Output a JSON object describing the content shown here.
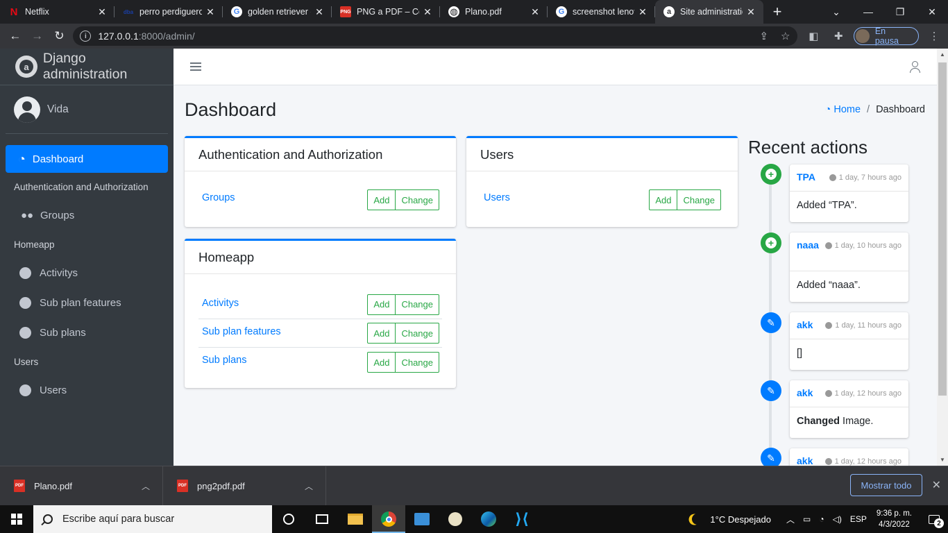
{
  "browser": {
    "tabs": [
      {
        "title": "Netflix",
        "favicon": "netflix-icon",
        "glyph": "N",
        "favicon_bg": "#202124",
        "favicon_fg": "#e50914"
      },
      {
        "title": "perro perdiguero",
        "favicon": "dba-icon",
        "glyph": "dba",
        "favicon_bg": "#202124",
        "favicon_fg": "#1a3fa6"
      },
      {
        "title": "golden retriever -",
        "favicon": "google-icon",
        "glyph": "G",
        "favicon_bg": "#ffffff",
        "favicon_fg": "#4285f4"
      },
      {
        "title": "PNG a PDF – Con",
        "favicon": "png2pdf-icon",
        "glyph": "P",
        "favicon_bg": "#d93025",
        "favicon_fg": "#ffffff"
      },
      {
        "title": "Plano.pdf",
        "favicon": "globe-icon",
        "glyph": "◍",
        "favicon_bg": "#ffffff",
        "favicon_fg": "#202124"
      },
      {
        "title": "screenshot lenov",
        "favicon": "google-icon",
        "glyph": "G",
        "favicon_bg": "#ffffff",
        "favicon_fg": "#4285f4"
      },
      {
        "title": "Site administratic",
        "favicon": "django-admin-icon",
        "glyph": "a",
        "favicon_bg": "#ffffff",
        "favicon_fg": "#35363a",
        "active": true
      }
    ],
    "url_host": "127.0.0.1",
    "url_path": ":8000/admin/",
    "profile_status": "En pausa"
  },
  "sidebar": {
    "brand": "Django administration",
    "user": "Vida",
    "dashboard_label": "Dashboard",
    "sections": [
      {
        "header": "Authentication and Authorization",
        "items": [
          {
            "label": "Groups",
            "icon": "users-icon"
          }
        ]
      },
      {
        "header": "Homeapp",
        "items": [
          {
            "label": "Activitys",
            "icon": "circle-icon"
          },
          {
            "label": "Sub plan features",
            "icon": "circle-icon"
          },
          {
            "label": "Sub plans",
            "icon": "circle-icon"
          }
        ]
      },
      {
        "header": "Users",
        "items": [
          {
            "label": "Users",
            "icon": "circle-icon"
          }
        ]
      }
    ]
  },
  "main": {
    "page_title": "Dashboard",
    "breadcrumb": {
      "home": "Home",
      "separator": "/",
      "current": "Dashboard"
    },
    "add_label": "Add",
    "change_label": "Change",
    "apps": [
      {
        "name": "Authentication and Authorization",
        "models": [
          "Groups"
        ]
      },
      {
        "name": "Users",
        "models": [
          "Users"
        ]
      },
      {
        "name": "Homeapp",
        "models": [
          "Activitys",
          "Sub plan features",
          "Sub plans"
        ]
      }
    ],
    "recent_actions": {
      "title": "Recent actions",
      "items": [
        {
          "object": "TPA",
          "time": "1 day, 7 hours ago",
          "type": "add",
          "verb": "",
          "text": "Added “TPA”."
        },
        {
          "object": "naaa",
          "time": "1 day, 10 hours ago",
          "type": "add",
          "verb": "",
          "text": "Added “naaa”."
        },
        {
          "object": "akk",
          "time": "1 day, 11 hours ago",
          "type": "change",
          "verb": "",
          "text": "[]"
        },
        {
          "object": "akk",
          "time": "1 day, 12 hours ago",
          "type": "change",
          "verb": "Changed",
          "text": " Image."
        },
        {
          "object": "akk",
          "time": "1 day, 12 hours ago",
          "type": "change",
          "verb": "",
          "text": ""
        }
      ]
    }
  },
  "downloads": {
    "items": [
      "Plano.pdf",
      "png2pdf.pdf"
    ],
    "file_badge": "PDF",
    "show_all": "Mostrar todo"
  },
  "taskbar": {
    "search_placeholder": "Escribe aquí para buscar",
    "weather": "1°C  Despejado",
    "language": "ESP",
    "time": "9:36 p. m.",
    "date": "4/3/2022",
    "notifications": "2"
  },
  "colors": {
    "primary": "#007bff",
    "success": "#28a745",
    "sidebar_bg": "#343a40"
  }
}
